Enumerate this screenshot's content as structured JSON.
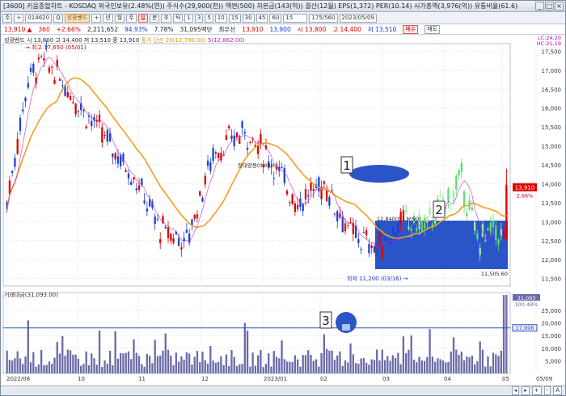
{
  "window": {
    "title": "[3600] 키움종합차트 - KOSDAQ 외국인보유(2.48%(연)) 주식수(29,900(천)) 액면(500) 자본금(143(억)) 결산(12월) EPS(1,372) PER(10.14) 시가총액(3,976(억)) 유통비율(61.6)",
    "buttons": [
      "_",
      "□",
      "×"
    ]
  },
  "toolbar": {
    "items": [
      "주",
      "+",
      "014620",
      "Q",
      "성광벤드",
      "+",
      "년",
      "월",
      "주",
      "일",
      "분",
      "초",
      "틱",
      "1",
      "3",
      "5",
      "10",
      "15",
      "30",
      "45",
      "60",
      "15",
      "175",
      "560",
      "2023/05/09"
    ],
    "stock_code": "014620",
    "stock_name": "성광벤드",
    "range": "175/560",
    "date": "2023/05/09"
  },
  "pricebar": {
    "price": "13,910 ▲",
    "change": "360",
    "change_pct": "+2.66%",
    "volume": "2,211,652",
    "ratio": "94.93%",
    "turnover": "7.78%",
    "amount": "31,095백만",
    "rank": "최우선",
    "ask": "13,910",
    "bid": "13,900",
    "open": "시 13,800",
    "high": "고 14,400",
    "low": "저 13,510",
    "buy_label": "매수",
    "sell_label": "매도"
  },
  "legends": {
    "price_line": "성광벤드 시 13,800 고 14,400 저 13,510 종 13,910",
    "ma1": "종가 단순 20(12,780.00)",
    "ma2": "5(12,862.00)",
    "volume": "거래대금(31,093.00)"
  },
  "annotations": {
    "high_label": "최고 17,650 (05/01)",
    "low_label": "최저 11,200 (03/16)",
    "mid_label": "12,840(0.13/.90)",
    "dn_label": "11,505.60",
    "note_label": "장대양봉(0.03%)",
    "box_numbers": [
      "1",
      "2",
      "3"
    ]
  },
  "y_axis": {
    "price_ticks": [
      "17,500",
      "17,000",
      "16,500",
      "16,000",
      "15,500",
      "15,000",
      "14,500",
      "14,000",
      "13,500",
      "13,000",
      "12,500",
      "12,000",
      "11,500"
    ],
    "price_top_labels": [
      "LC:24,20",
      "HC:21,19"
    ],
    "current_price": "13,910",
    "current_pct": "2.66%",
    "volume_ticks": [
      "25,000",
      "20,000",
      "15,000",
      "10,000",
      "5,000"
    ],
    "volume_top": "31,093",
    "volume_top2": "100.48%",
    "volume_ma": "17,998"
  },
  "x_axis": {
    "labels": [
      "2022/08",
      "10",
      "11",
      "12",
      "2023/01",
      "02",
      "03",
      "04",
      "05",
      "05/09"
    ]
  },
  "bottom": {
    "items": [
      "◂",
      "▸",
      "+",
      "-",
      "A"
    ]
  },
  "colors": {
    "up": "#e00000",
    "down": "#1a40d8",
    "ma20": "#f0a020",
    "ma5": "#c020c0",
    "box_fill": "#2a55c8",
    "volume_bar": "#6a6aa8"
  }
}
